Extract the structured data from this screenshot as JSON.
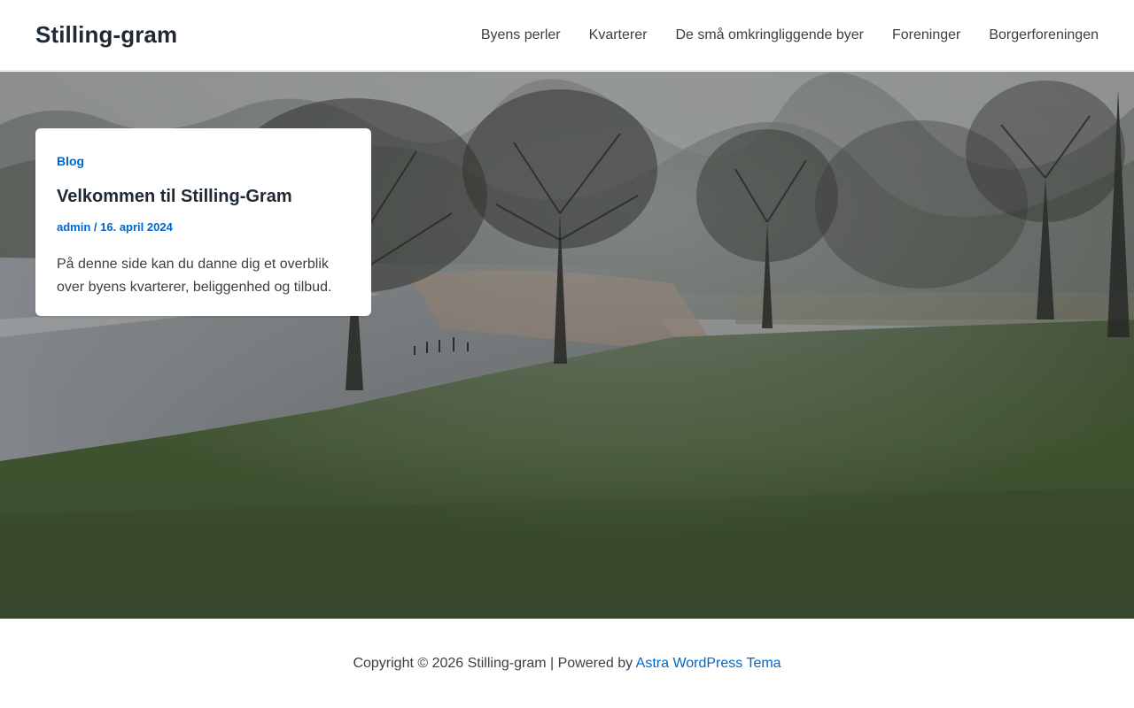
{
  "header": {
    "site_title": "Stilling-gram",
    "nav": [
      {
        "label": "Byens perler"
      },
      {
        "label": "Kvarterer"
      },
      {
        "label": "De små omkringliggende byer"
      },
      {
        "label": "Foreninger"
      },
      {
        "label": "Borgerforeningen"
      }
    ]
  },
  "post": {
    "category": "Blog",
    "title": "Velkommen til Stilling-Gram",
    "author": "admin",
    "separator": " / ",
    "date": "16. april 2024",
    "excerpt": "På denne side kan du danne dig et overblik over byens kvarterer, beliggenhed og tilbud."
  },
  "footer": {
    "copyright": "Copyright © 2026 Stilling-gram | Powered by ",
    "theme_link": "Astra WordPress Tema"
  },
  "colors": {
    "accent": "#0066cc",
    "heading": "#1f2933",
    "text": "#3a3f44"
  }
}
